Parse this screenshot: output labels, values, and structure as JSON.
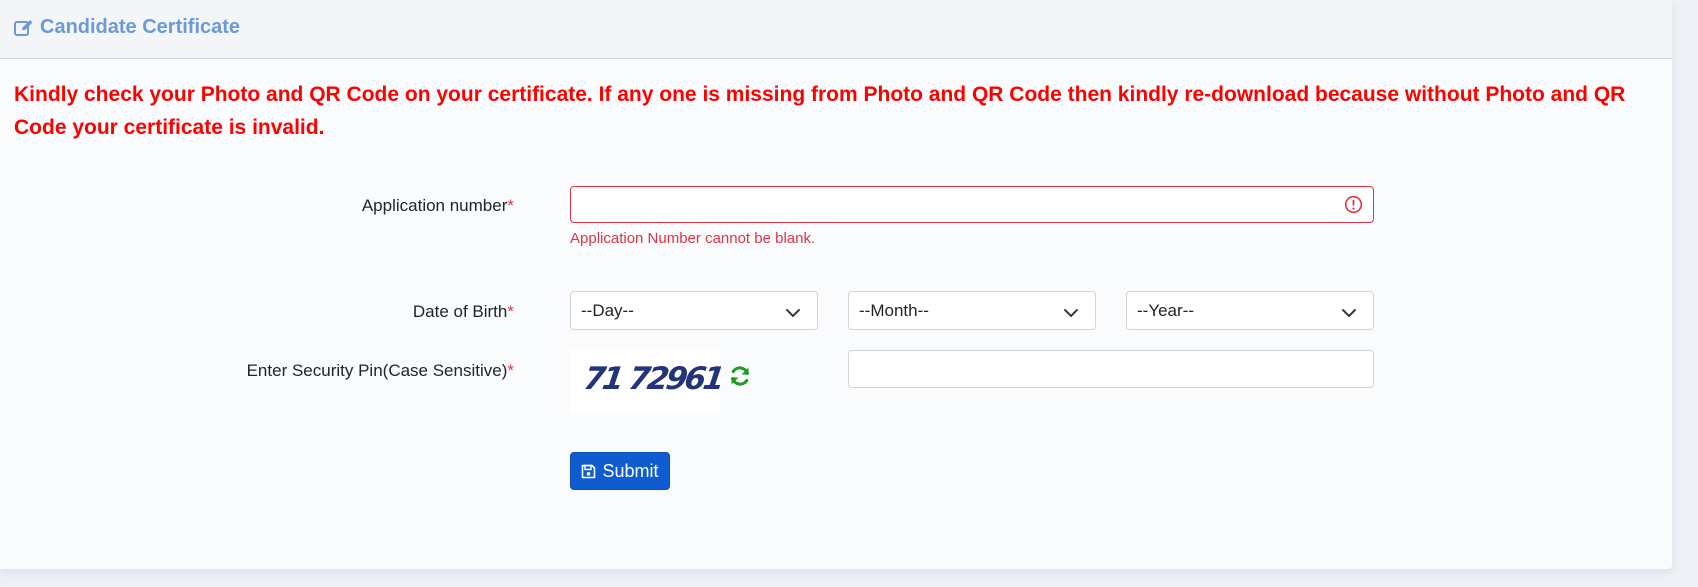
{
  "header": {
    "title": "Candidate Certificate",
    "icon": "edit-icon",
    "color": "#6a9ad8"
  },
  "notice": {
    "text": "Kindly check your Photo and QR Code on your certificate. If any one is missing from Photo and QR Code then kindly re-download because without Photo and QR Code your certificate is invalid.",
    "color": "#ff0000"
  },
  "form": {
    "application_number": {
      "label": "Application number",
      "required_mark": "*",
      "value": "",
      "error": "Application Number cannot be blank."
    },
    "dob": {
      "label": "Date of Birth",
      "required_mark": "*",
      "day": "--Day--",
      "month": "--Month--",
      "year": "--Year--"
    },
    "security_pin": {
      "label": "Enter Security Pin(Case Sensitive)",
      "required_mark": "*",
      "captcha": "71 72961",
      "value": ""
    },
    "submit_label": "Submit"
  },
  "colors": {
    "error": "#dc3545",
    "button": "#0f5bd0",
    "refresh": "#1e9a1e"
  }
}
